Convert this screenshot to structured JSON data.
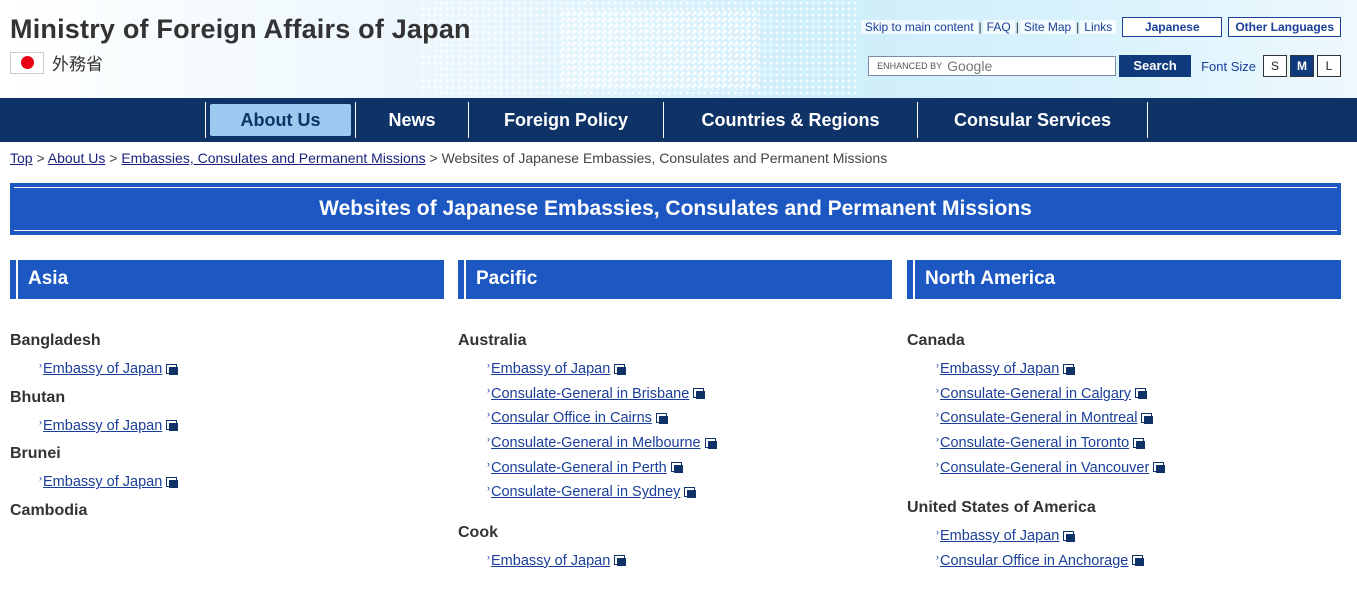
{
  "header": {
    "title": "Ministry of Foreign Affairs of Japan",
    "japanese_name": "外務省",
    "top_links": [
      "Skip to main content",
      "FAQ",
      "Site Map",
      "Links"
    ],
    "lang_japanese": "Japanese",
    "lang_other": "Other Languages",
    "search_placeholder": "ENHANCED BY",
    "search_brand": "Google",
    "search_button": "Search",
    "font_size_label": "Font Size",
    "font_sizes": [
      "S",
      "M",
      "L"
    ],
    "active_font_size": "M"
  },
  "nav": {
    "items": [
      "About Us",
      "News",
      "Foreign Policy",
      "Countries & Regions",
      "Consular Services"
    ],
    "active": "About Us"
  },
  "breadcrumb": {
    "links": [
      "Top",
      "About Us",
      "Embassies, Consulates and Permanent Missions"
    ],
    "current": "Websites of Japanese Embassies, Consulates and Permanent Missions",
    "separator": ">"
  },
  "page_title": "Websites of Japanese Embassies, Consulates and Permanent Missions",
  "regions": [
    {
      "name": "Asia",
      "countries": [
        {
          "name": "Bangladesh",
          "links": [
            "Embassy of Japan"
          ]
        },
        {
          "name": "Bhutan",
          "links": [
            "Embassy of Japan"
          ]
        },
        {
          "name": "Brunei",
          "links": [
            "Embassy of Japan"
          ]
        },
        {
          "name": "Cambodia",
          "links": []
        }
      ]
    },
    {
      "name": "Pacific",
      "countries": [
        {
          "name": "Australia",
          "links": [
            "Embassy of Japan",
            "Consulate-General in Brisbane",
            "Consular Office in Cairns",
            "Consulate-General in Melbourne",
            "Consulate-General in Perth",
            "Consulate-General in Sydney"
          ]
        },
        {
          "name": "Cook",
          "links": [
            "Embassy of Japan"
          ]
        }
      ]
    },
    {
      "name": "North America",
      "countries": [
        {
          "name": "Canada",
          "links": [
            "Embassy of Japan",
            "Consulate-General in Calgary",
            "Consulate-General in Montreal",
            "Consulate-General in Toronto",
            "Consulate-General in Vancouver"
          ]
        },
        {
          "name": "United States of America",
          "links": [
            "Embassy of Japan",
            "Consular Office in Anchorage"
          ]
        }
      ]
    }
  ]
}
